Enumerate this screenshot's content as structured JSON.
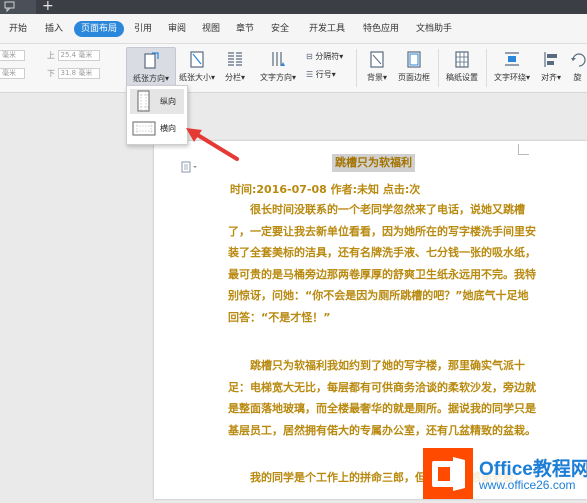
{
  "menu": {
    "items": [
      "开始",
      "插入",
      "页面布局",
      "引用",
      "审阅",
      "视图",
      "章节",
      "安全",
      "开发工具",
      "特色应用",
      "文档助手"
    ],
    "active_index": 2
  },
  "ribbon": {
    "margin_top_label": "上",
    "margin_top_value": "25.4 毫米",
    "margin_bottom_label": "下",
    "margin_bottom_value": "31.8 毫米",
    "margin_left_value": "毫米",
    "margin_left2_value": "毫米",
    "orientation": "纸张方向",
    "size": "纸张大小",
    "columns": "分栏",
    "text_direction": "文字方向",
    "separator": "分隔符",
    "line_numbers": "行号",
    "background": "背景",
    "page_border": "页面边框",
    "grid_setting": "稿纸设置",
    "text_wrap": "文字环绕",
    "align": "对齐",
    "rotate": "旋"
  },
  "dropdown": {
    "portrait": "纵向",
    "landscape": "横向"
  },
  "document": {
    "title": "跳槽只为软福利",
    "meta": "时间:2016-07-08  作者:未知  点击:次",
    "para1": [
      "很长时间没联系的一个老同学忽然来了电话，说她又跳槽",
      "了，一定要让我去新单位看看，因为她所在的写字楼洗手间里安",
      "装了全套美标的洁具，还有名牌洗手液、七分钱一张的吸水纸，",
      "最可贵的是马桶旁边那两卷厚厚的舒爽卫生纸永远用不完。我特",
      "别惊讶，问她：“你不会是因为厕所跳槽的吧？”她底气十足地",
      "回答：“不是才怪！”"
    ],
    "para2": [
      "跳槽只为软福利我如约到了她的写字楼，那里确实气派十",
      "足：电梯宽大无比，每层都有可供商务洽谈的柔软沙发，旁边就",
      "是整面落地玻璃，而全楼最奢华的就是厕所。据说我的同学只是",
      "基层员工，居然拥有偌大的专属办公室，还有几盆精致的盆栽。"
    ],
    "para3": [
      "我的同学是个工作上的拼命三郎，但她说她要感谢老板，"
    ]
  },
  "watermark": {
    "brand": "Office教程网",
    "url": "www.office26.com"
  },
  "colors": {
    "accent": "#2b87d9",
    "doc_text": "#b98a10",
    "arrow": "#e53935",
    "logo_orange": "#ff4a00"
  }
}
